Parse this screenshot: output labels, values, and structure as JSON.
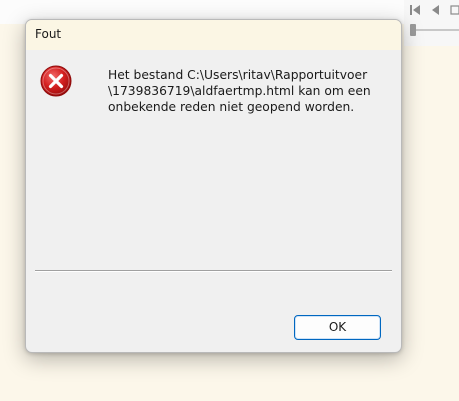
{
  "dialog": {
    "title": "Fout",
    "icon": "error-icon",
    "message_lines": [
      "Het bestand C:\\Users\\ritav\\Rapportuitvoer",
      "\\1739836719\\aldfaertmp.html kan om een",
      "onbekende reden niet geopend worden."
    ],
    "ok_label": "OK"
  },
  "background_toolbar": {
    "icons": [
      "first-frame-icon",
      "previous-frame-icon",
      "stop-icon"
    ]
  },
  "colors": {
    "error_red": "#d42020",
    "button_accent": "#0067c0",
    "dialog_bg": "#f0f0f0",
    "titlebar_bg": "#fbf6e4"
  }
}
